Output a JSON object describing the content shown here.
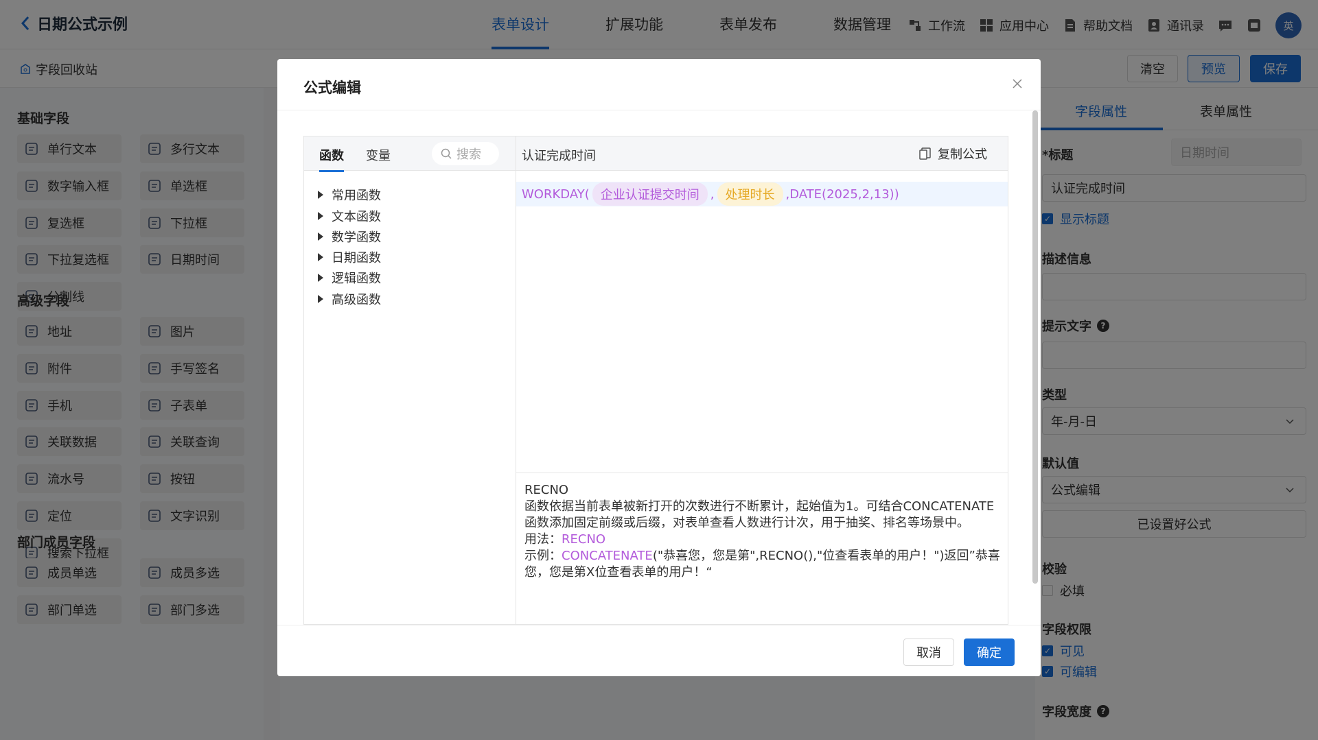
{
  "header": {
    "title": "日期公式示例",
    "tabs": [
      {
        "label": "表单设计",
        "active": true
      },
      {
        "label": "扩展功能"
      },
      {
        "label": "表单发布"
      },
      {
        "label": "数据管理"
      }
    ],
    "right_items": [
      {
        "label": "工作流",
        "icon": "workflow-icon"
      },
      {
        "label": "应用中心",
        "icon": "app-center-icon"
      },
      {
        "label": "帮助文档",
        "icon": "help-doc-icon"
      },
      {
        "label": "通讯录",
        "icon": "contacts-icon"
      }
    ],
    "avatar": "英"
  },
  "subbar": {
    "recycle_label": "字段回收站",
    "clear_label": "清空",
    "preview_label": "预览",
    "save_label": "保存"
  },
  "palette": {
    "groups": [
      {
        "title": "基础字段",
        "fields": [
          "单行文本",
          "多行文本",
          "数字输入框",
          "单选框",
          "复选框",
          "下拉框",
          "下拉复选框",
          "日期时间",
          "分割线"
        ]
      },
      {
        "title": "高级字段",
        "fields": [
          "地址",
          "图片",
          "附件",
          "手写签名",
          "手机",
          "子表单",
          "关联数据",
          "关联查询",
          "流水号",
          "按钮",
          "定位",
          "文字识别",
          "搜索下拉框"
        ]
      },
      {
        "title": "部门成员字段",
        "fields": [
          "成员单选",
          "成员多选",
          "部门单选",
          "部门多选"
        ]
      }
    ]
  },
  "right_panel": {
    "tab_field": "字段属性",
    "tab_form": "表单属性",
    "title_label": "*标题",
    "title_type": "日期时间",
    "title_value": "认证完成时间",
    "show_title": "显示标题",
    "desc_label": "描述信息",
    "hint_label": "提示文字",
    "type_label": "类型",
    "type_value": "年-月-日",
    "default_label": "默认值",
    "default_value": "公式编辑",
    "formula_set": "已设置好公式",
    "validate_label": "校验",
    "required": "必填",
    "perm_label": "字段权限",
    "visible": "可见",
    "editable": "可编辑",
    "width_label": "字段宽度"
  },
  "modal": {
    "title": "公式编辑",
    "tab_functions": "函数",
    "tab_variables": "变量",
    "search_placeholder": "搜索",
    "function_groups": [
      "常用函数",
      "文本函数",
      "数学函数",
      "日期函数",
      "逻辑函数",
      "高级函数"
    ],
    "field_name": "认证完成时间",
    "copy_label": "复制公式",
    "formula": {
      "fn": "WORKDAY(",
      "arg1": "企业认证提交时间",
      "sep": ",",
      "arg2": "处理时长",
      "rest": ",DATE(2025,2,13))"
    },
    "help": {
      "name": "RECNO",
      "text": "函数依据当前表单被新打开的次数进行不断累计，起始值为1。可结合CONCATENATE 函数添加固定前缀或后缀，对表单查看人数进行计次，用于抽奖、排名等场景中。",
      "usage_label": "用法：",
      "usage_value": "RECNO",
      "example_label": "示例：",
      "example_fn": "CONCATENATE",
      "example_rest": "(\"恭喜您，您是第\",RECNO(),\"位查看表单的用户！\")返回”恭喜您，您是第X位查看表单的用户！“"
    },
    "cancel_label": "取消",
    "ok_label": "确定"
  },
  "colors": {
    "primary": "#1a6fd6",
    "function_purple": "#b35bdb",
    "tag_yellow": "#e5a823"
  }
}
